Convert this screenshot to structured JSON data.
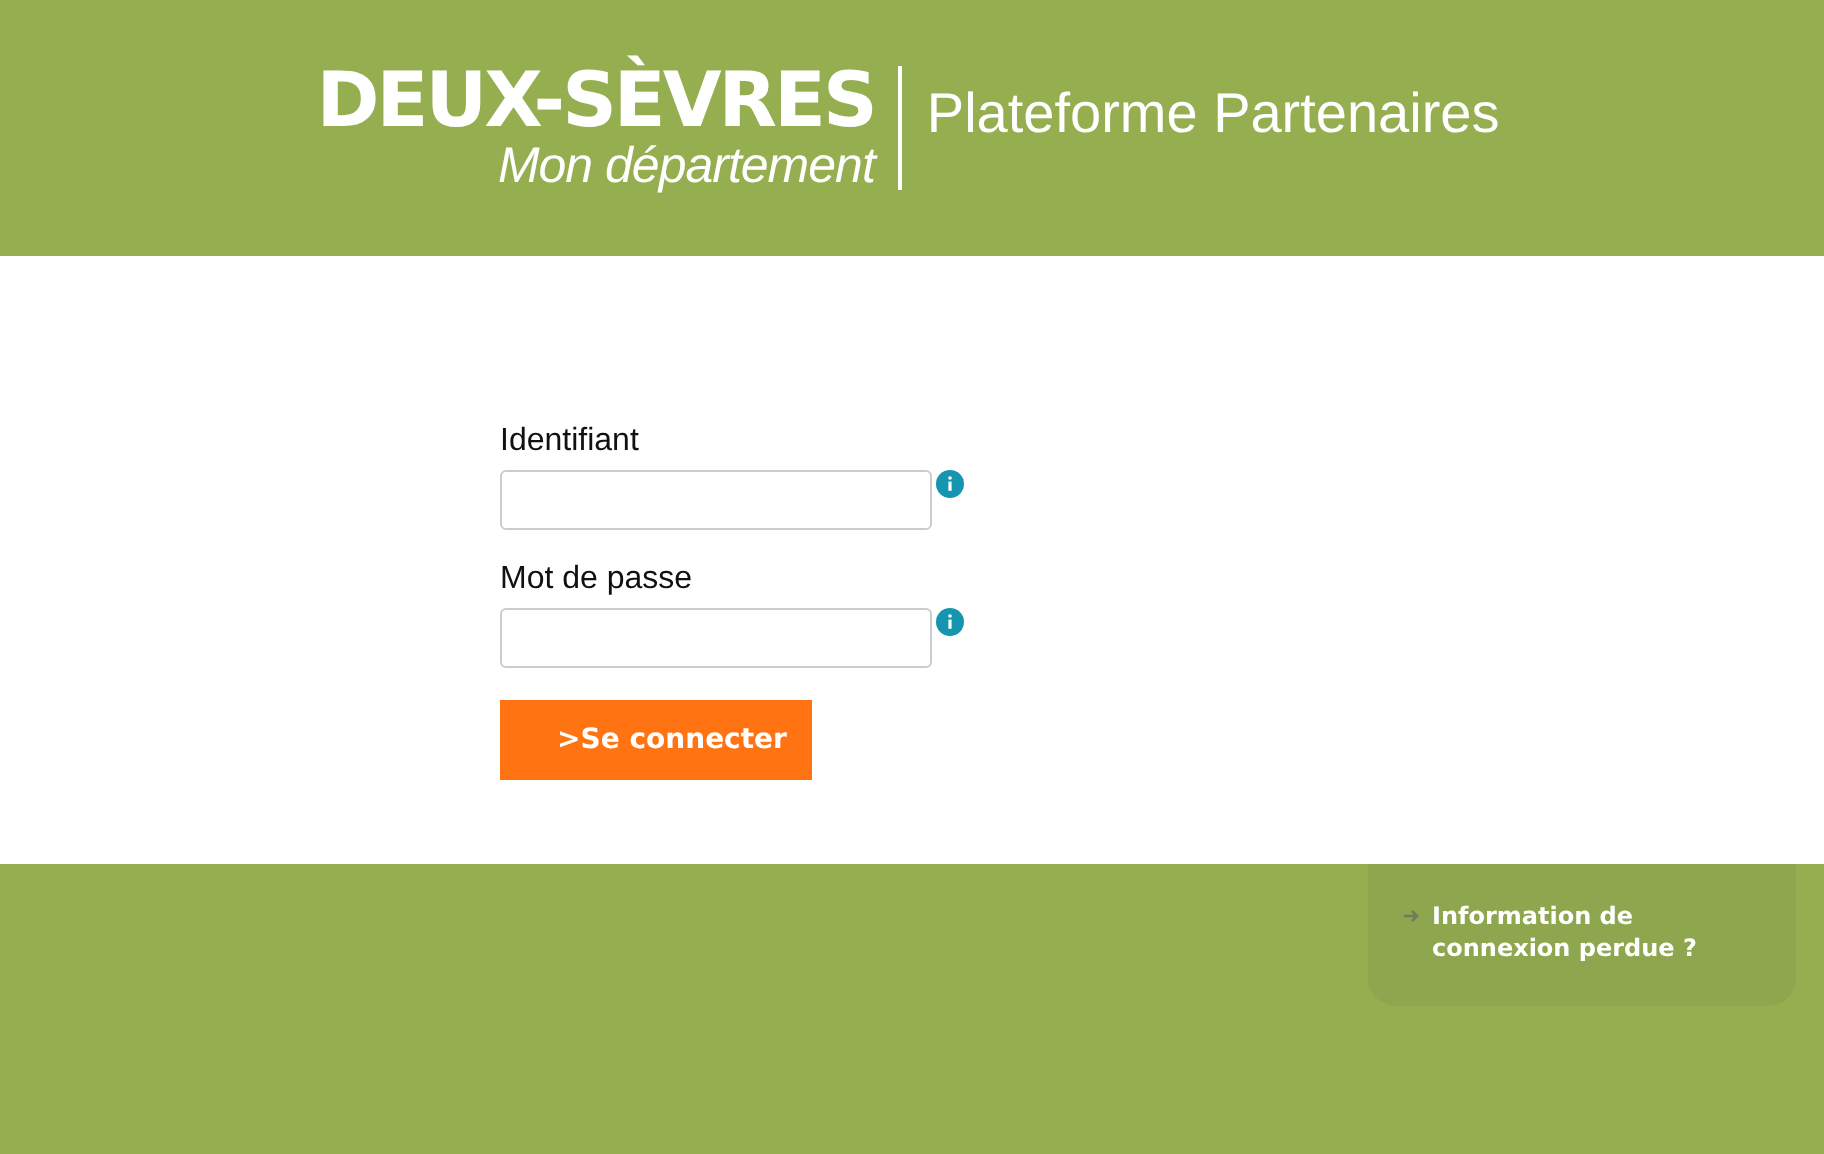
{
  "header": {
    "logo_title": "DEUX-SÈVRES",
    "logo_subtitle": "Mon département",
    "site_title": "Plateforme Partenaires"
  },
  "form": {
    "fields": [
      {
        "label": "Identifiant"
      },
      {
        "label": "Mot de passe"
      }
    ],
    "submit": ">Se connecter"
  },
  "footer": {
    "link": "Information de connexion perdue ?"
  }
}
